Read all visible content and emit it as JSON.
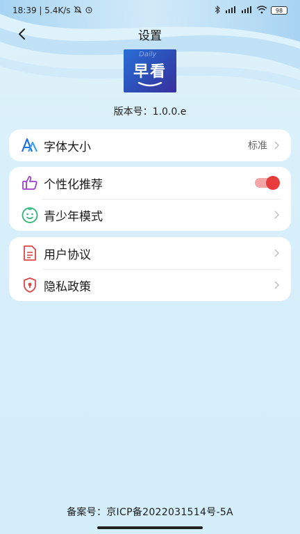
{
  "status": {
    "time_speed": "18:39 | 5.4K/s",
    "battery": "98"
  },
  "header": {
    "title": "设置"
  },
  "logo": {
    "watermark": "Daily",
    "text": "早看"
  },
  "version": "版本号：1.0.0.e",
  "settings": {
    "font_size": {
      "label": "字体大小",
      "value": "标准"
    },
    "personalized": {
      "label": "个性化推荐",
      "enabled": true
    },
    "youth_mode": {
      "label": "青少年模式"
    },
    "user_agreement": {
      "label": "用户协议"
    },
    "privacy_policy": {
      "label": "隐私政策"
    }
  },
  "filing": "备案号：京ICP备2022031514号-5A",
  "colors": {
    "accent_blue": "#1e6fe6",
    "toggle_on": "#e83c3c",
    "icon_purple": "#9b3fc9",
    "icon_green": "#2bb673",
    "icon_red": "#e04545"
  }
}
